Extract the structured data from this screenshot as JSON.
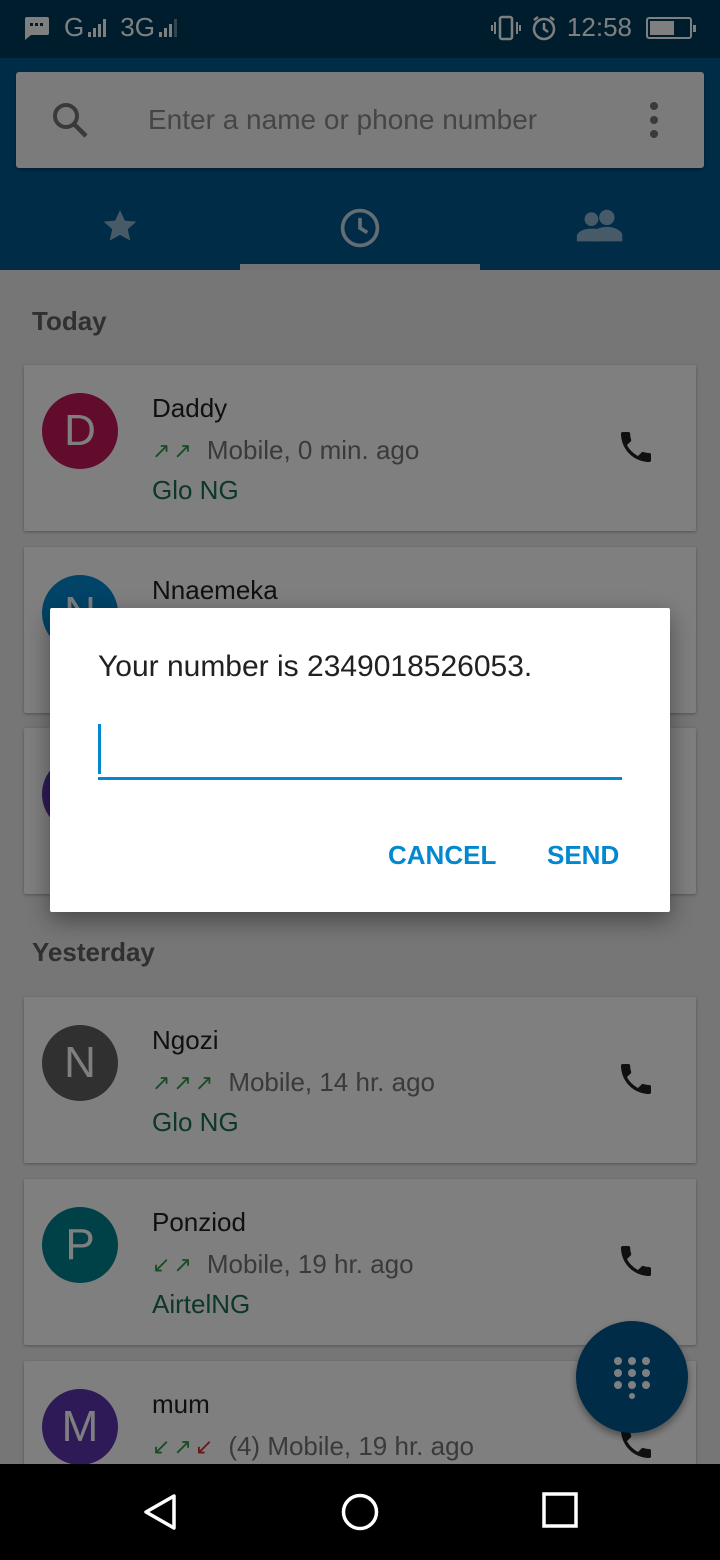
{
  "status_bar": {
    "network_1": "G",
    "network_2": "3G",
    "time": "12:58"
  },
  "search": {
    "placeholder": "Enter a name or phone number"
  },
  "tabs": [
    {
      "icon": "star-icon",
      "active": false
    },
    {
      "icon": "clock-icon",
      "active": true
    },
    {
      "icon": "contacts-icon",
      "active": false
    }
  ],
  "sections": {
    "today": "Today",
    "yesterday": "Yesterday"
  },
  "calls": [
    {
      "initial": "D",
      "name": "Daddy",
      "arrows": "↗↗",
      "detail": "Mobile, 0 min. ago",
      "carrier": "Glo NG",
      "color": "#c2185b"
    },
    {
      "initial": "N",
      "name": "Nnaemeka",
      "color": "#0288d1"
    },
    {
      "initial": "N",
      "name": "Ngozi",
      "arrows": "↗↗↗",
      "detail": "Mobile, 14 hr. ago",
      "carrier": "Glo NG",
      "color": "#616161"
    },
    {
      "initial": "P",
      "name": "Ponziod",
      "arrows_in": "↙",
      "arrows": "↗",
      "detail": "Mobile, 19 hr. ago",
      "carrier": "AirtelNG",
      "color": "#00838f"
    },
    {
      "initial": "M",
      "name": "mum",
      "arrows_in": "↙",
      "arrows": "↗",
      "arrows_missed": "↙",
      "detail": "(4) Mobile, 19 hr. ago",
      "color": "#5e35b1"
    }
  ],
  "dialog": {
    "message": "Your number is 2349018526053.",
    "input_value": "",
    "cancel_label": "CANCEL",
    "send_label": "SEND"
  },
  "colors": {
    "status_bar": "#003a5c",
    "header": "#01588f",
    "accent": "#0288d1"
  }
}
